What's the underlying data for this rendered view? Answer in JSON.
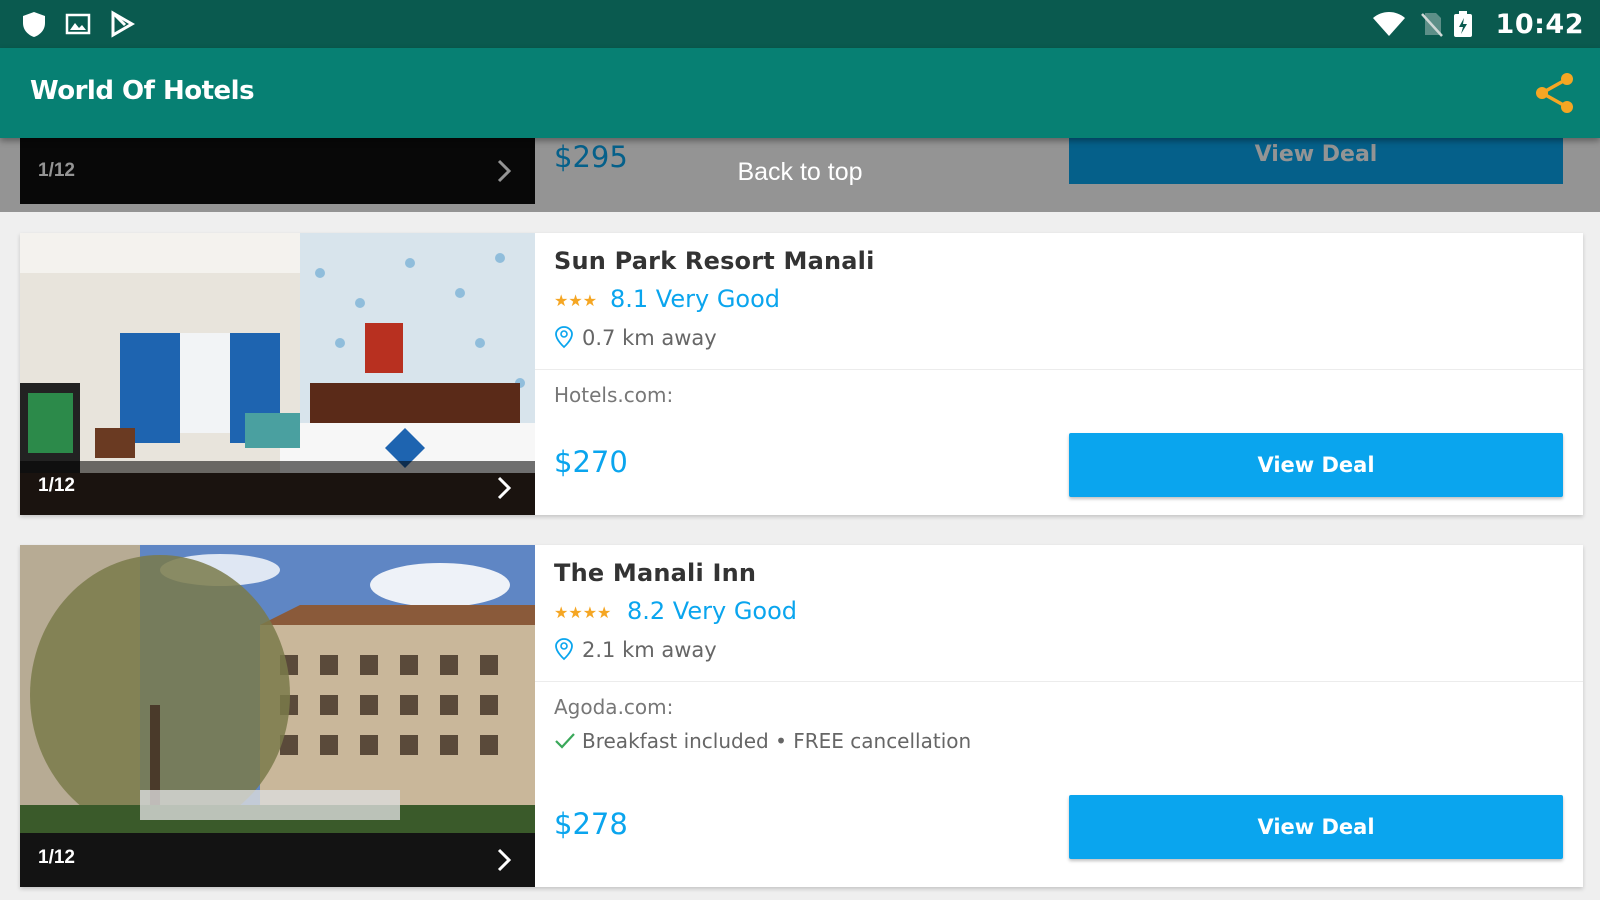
{
  "status_bar": {
    "time": "10:42",
    "left_icons": [
      "shield-icon",
      "image-icon",
      "play-store-icon"
    ],
    "right_icons": [
      "wifi-icon",
      "no-sim-icon",
      "battery-icon"
    ]
  },
  "app_bar": {
    "title": "World Of Hotels",
    "share_icon": "share-icon",
    "share_color": "#f5a623"
  },
  "colors": {
    "accent": "#0aa5ee",
    "app_bar": "#078073",
    "status_bar": "#0a5a4f",
    "star": "#f5a623"
  },
  "back_to_top": "Back to top",
  "top_card": {
    "counter": "1/12",
    "price": "$295",
    "deal_label": "View Deal"
  },
  "hotels": [
    {
      "name": "Sun Park Resort Manali",
      "stars": "★★★",
      "star_count": 3,
      "rating": "8.1 Very Good",
      "distance": "0.7 km away",
      "provider": "Hotels.com:",
      "perks": "",
      "price": "$270",
      "deal_label": "View Deal",
      "counter": "1/12"
    },
    {
      "name": "The Manali Inn",
      "stars": "★★★★",
      "star_count": 4,
      "rating": "8.2 Very Good",
      "distance": "2.1 km away",
      "provider": "Agoda.com:",
      "perks": "Breakfast included • FREE cancellation",
      "price": "$278",
      "deal_label": "View Deal",
      "counter": "1/12"
    }
  ]
}
